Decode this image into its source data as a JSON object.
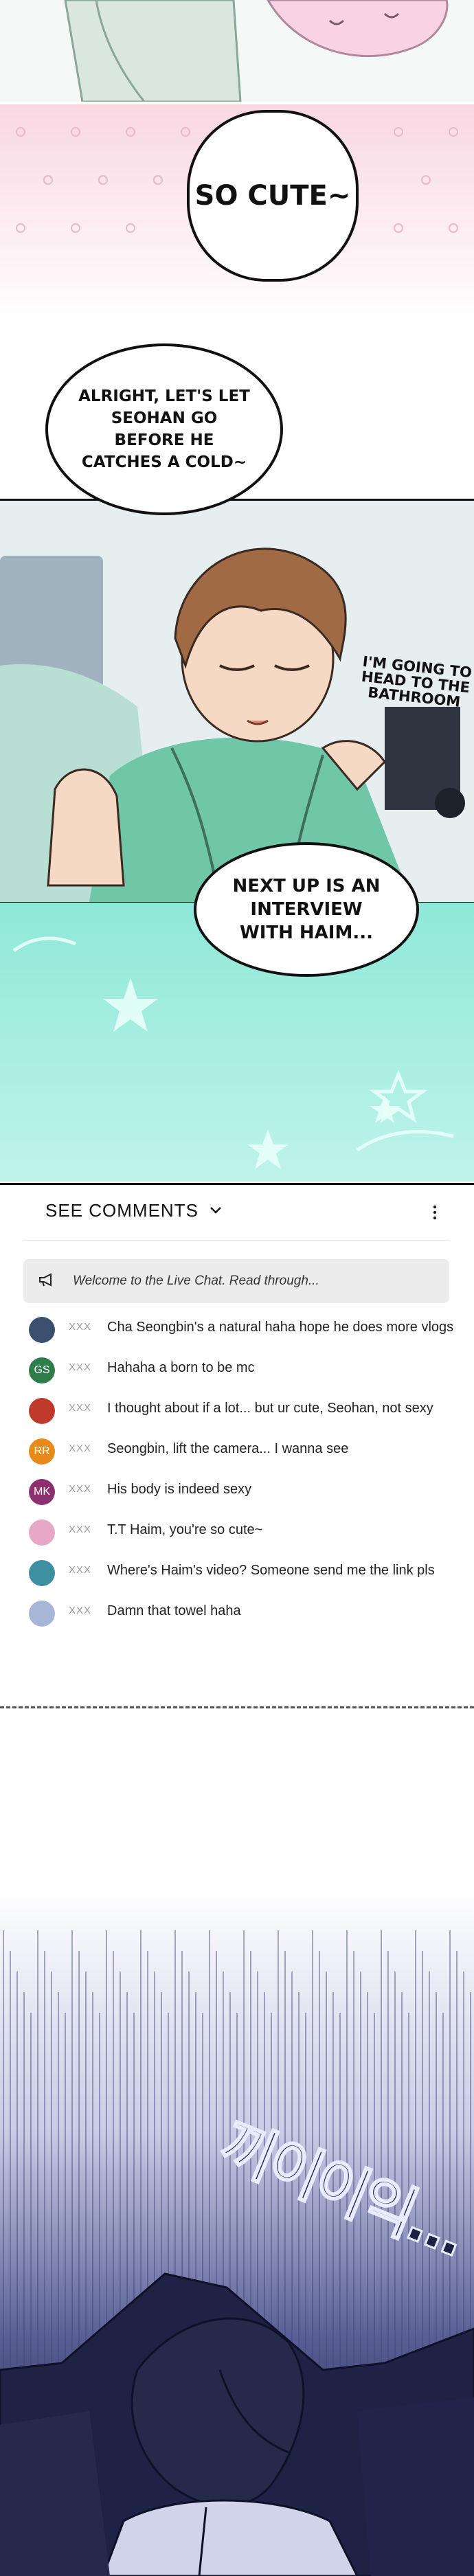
{
  "speech": {
    "so_cute": "SO CUTE~",
    "alright": "ALRIGHT, LET'S LET SEOHAN GO BEFORE HE CATCHES A COLD~",
    "bathroom": "I'M GOING TO HEAD TO THE BATHROOM",
    "next_up": "NEXT UP IS AN INTERVIEW WITH HAIM..."
  },
  "comments": {
    "header": "SEE COMMENTS",
    "pinned": "Welcome to the Live Chat. Read through...",
    "items": [
      {
        "initials": "",
        "user": "XXX",
        "text": "Cha Seongbin's a natural haha hope he does more vlogs",
        "color": "#3b4f6e"
      },
      {
        "initials": "GS",
        "user": "XXX",
        "text": "Hahaha a born to be mc",
        "color": "#2f7d4a"
      },
      {
        "initials": "",
        "user": "XXX",
        "text": "I thought about if a lot... but ur cute, Seohan, not sexy",
        "color": "#c0392b"
      },
      {
        "initials": "RR",
        "user": "XXX",
        "text": "Seongbin, lift the camera... I wanna see",
        "color": "#e8891a"
      },
      {
        "initials": "MK",
        "user": "XXX",
        "text": "His body is indeed sexy",
        "color": "#8e2f6e"
      },
      {
        "initials": "",
        "user": "XXX",
        "text": "T.T Haim, you're so cute~",
        "color": "#e7a7c6"
      },
      {
        "initials": "",
        "user": "XXX",
        "text": "Where's Haim's video? Someone send me the link pls",
        "color": "#3e8fa0"
      },
      {
        "initials": "",
        "user": "XXX",
        "text": "Damn that towel haha",
        "color": "#a7b6d8"
      }
    ]
  },
  "sfx": {
    "text": "끼이이익..."
  }
}
